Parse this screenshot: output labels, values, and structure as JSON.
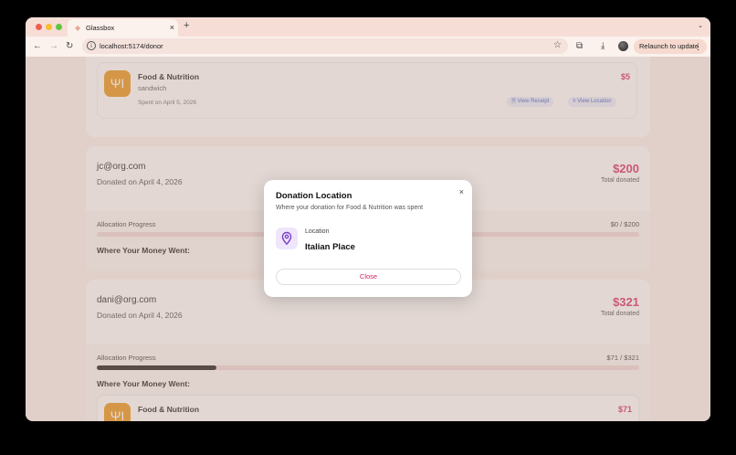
{
  "browser": {
    "tab_title": "Glassbox",
    "tab_close": "×",
    "new_tab": "+",
    "tab_menu": "⌄",
    "url": "localhost:5174/donor",
    "relaunch_label": "Relaunch to update",
    "back": "←",
    "forward": "→",
    "reload": "↻",
    "star": "☆",
    "extensions": "⧉",
    "download": "⤓",
    "more": "⋮"
  },
  "top_card": {
    "transaction": {
      "category": "Food & Nutrition",
      "item": "sandwich",
      "date": "Spent on April 5, 2026",
      "amount": "$5",
      "receipt_label": "View Receipt",
      "location_label": "View Location",
      "icon": "fork-knife-icon"
    }
  },
  "donations": [
    {
      "email": "jc@org.com",
      "donated_on": "Donated on April 4, 2026",
      "total": "$200",
      "total_label": "Total donated",
      "allocation_label": "Allocation Progress",
      "allocation_value": "$0 / $200",
      "allocation_fraction": 0,
      "where_label": "Where Your Money Went:"
    },
    {
      "email": "dani@org.com",
      "donated_on": "Donated on April 4, 2026",
      "total": "$321",
      "total_label": "Total donated",
      "allocation_label": "Allocation Progress",
      "allocation_value": "$71 / $321",
      "allocation_fraction": 0.221,
      "where_label": "Where Your Money Went:",
      "transaction": {
        "category": "Food & Nutrition",
        "amount": "$71"
      }
    }
  ],
  "modal": {
    "title": "Donation Location",
    "description": "Where your donation for Food & Nutrition was spent",
    "location_label": "Location",
    "location_value": "Italian Place",
    "close_button": "Close",
    "close_x": "×"
  },
  "colors": {
    "accent": "#d6265c",
    "category_icon_bg": "#e8920f",
    "pill_text": "#3b56c9",
    "pin_icon": "#7b3fc9"
  }
}
